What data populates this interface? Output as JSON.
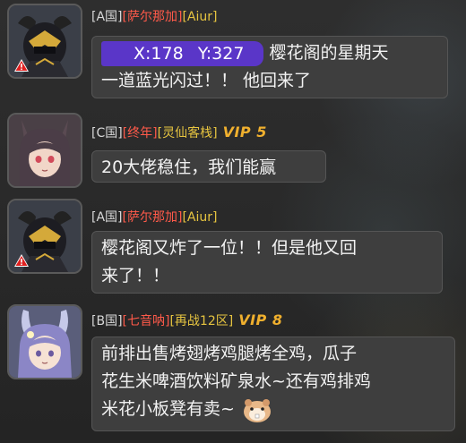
{
  "messages": [
    {
      "nation": "[A国]",
      "name": "[萨尔那加]",
      "guild": "[Aiur]",
      "vip": "",
      "coord_x": "X:178",
      "coord_y": "Y:327",
      "line1": "樱花阁的星期天",
      "line2": "一道蓝光闪过！！ 他回来了"
    },
    {
      "nation": "[C国]",
      "name": "[终年]",
      "guild": "[灵仙客栈]",
      "vip": "VIP 5",
      "line1": "20大佬稳住，我们能赢"
    },
    {
      "nation": "[A国]",
      "name": "[萨尔那加]",
      "guild": "[Aiur]",
      "vip": "",
      "line1": "樱花阁又炸了一位！！但是他又回",
      "line2": "来了！！"
    },
    {
      "nation": "[B国]",
      "name": "[七音呐]",
      "guild": "[再战12区]",
      "vip": "VIP 8",
      "line1": "前排出售烤翅烤鸡腿烤全鸡，瓜子",
      "line2": "花生米啤酒饮料矿泉水~还有鸡排鸡",
      "line3": "米花小板凳有卖~"
    }
  ],
  "icons": {
    "warning": "warning-icon",
    "emoji": "hamster-emoji-icon"
  },
  "colors": {
    "name_red": "#ff5a4a",
    "guild_gold": "#e6c440",
    "vip_orange": "#f0b02e",
    "coord_purple": "#5a36c8"
  }
}
